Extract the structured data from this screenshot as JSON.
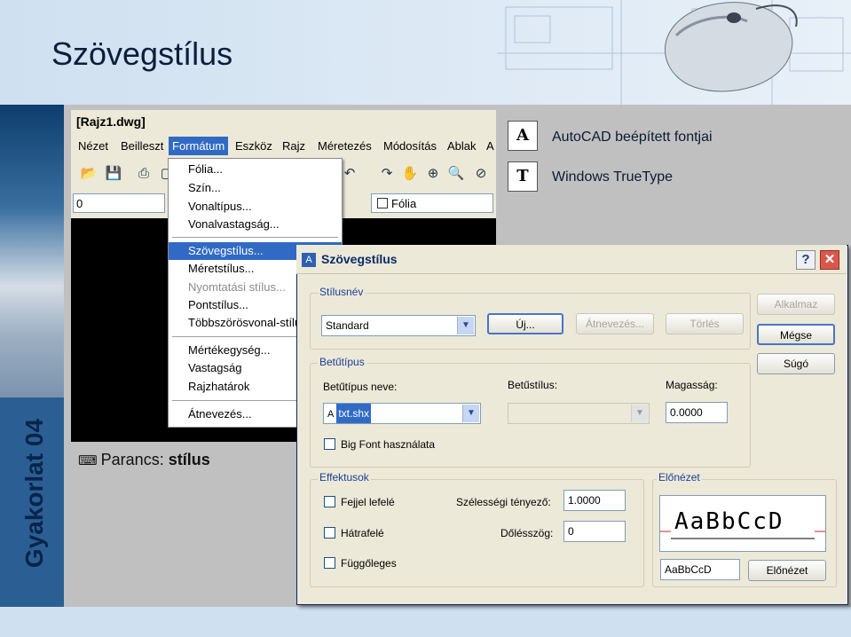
{
  "slide": {
    "title": "Szövegstílus",
    "side_label": "Gyakorlat 04"
  },
  "acad": {
    "window_title": "[Rajz1.dwg]",
    "menu": [
      "Nézet",
      "Beilleszt",
      "Formátum",
      "Eszköz",
      "Rajz",
      "Méretezés",
      "Módosítás",
      "Ablak",
      "A"
    ],
    "active_menu": "Formátum",
    "field_value": "0",
    "layer_value": "Fólia",
    "dropdown": {
      "items": [
        {
          "label": "Fólia...",
          "state": "normal"
        },
        {
          "label": "Szín...",
          "state": "normal"
        },
        {
          "label": "Vonaltípus...",
          "state": "normal"
        },
        {
          "label": "Vonalvastagság...",
          "state": "normal"
        },
        {
          "label": "Szövegstílus...",
          "state": "selected"
        },
        {
          "label": "Méretstílus...",
          "state": "normal"
        },
        {
          "label": "Nyomtatási stílus...",
          "state": "disabled"
        },
        {
          "label": "Pontstílus...",
          "state": "normal"
        },
        {
          "label": "Többszörösvonal-stílus...",
          "state": "normal"
        },
        {
          "label": "Mértékegység...",
          "state": "normal"
        },
        {
          "label": "Vastagság",
          "state": "normal"
        },
        {
          "label": "Rajzhatárok",
          "state": "normal"
        },
        {
          "label": "Átnevezés...",
          "state": "normal"
        }
      ]
    },
    "command_prefix": "Parancs:",
    "command_value": "stílus"
  },
  "font_types": [
    {
      "icon": "autocad-font-icon",
      "glyph": "A",
      "label": "AutoCAD beépített fontjai"
    },
    {
      "icon": "truetype-font-icon",
      "glyph": "T",
      "label": "Windows TrueType"
    }
  ],
  "dialog": {
    "title": "Szövegstílus",
    "help_label": "?",
    "close_label": "✕",
    "style_group": {
      "label": "Stílusnév",
      "value": "Standard",
      "new_label": "Új...",
      "rename_label": "Átnevezés...",
      "delete_label": "Törlés"
    },
    "side_buttons": {
      "apply": "Alkalmaz",
      "cancel": "Mégse",
      "help": "Súgó"
    },
    "font_group": {
      "label": "Betűtípus",
      "font_name_label": "Betűtípus neve:",
      "font_name_value": "txt.shx",
      "font_style_label": "Betűstílus:",
      "height_label": "Magasság:",
      "height_value": "0.0000",
      "bigfont_label": "Big Font használata"
    },
    "effects_group": {
      "label": "Effektusok",
      "upside_down": "Fejjel lefelé",
      "backwards": "Hátrafelé",
      "vertical": "Függőleges",
      "width_factor_label": "Szélességi tényező:",
      "width_factor_value": "1.0000",
      "oblique_label": "Dőlésszög:",
      "oblique_value": "0"
    },
    "preview_group": {
      "label": "Előnézet",
      "sample": "AaBbCcD",
      "input_value": "AaBbCcD",
      "button": "Előnézet"
    }
  }
}
